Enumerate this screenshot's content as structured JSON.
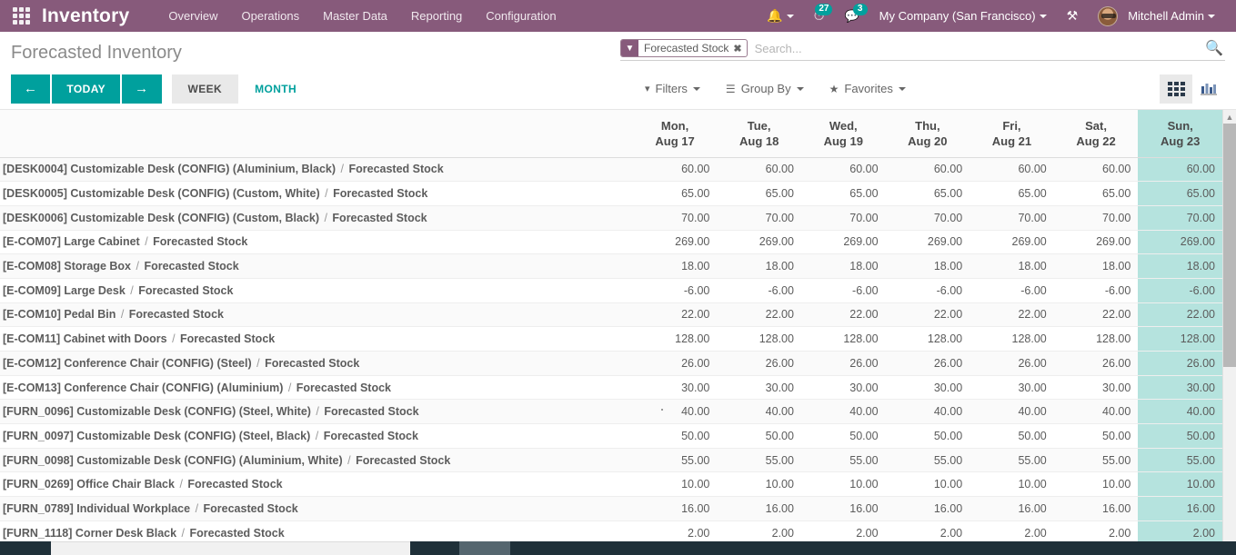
{
  "navbar": {
    "apps_icon": "apps-grid-icon",
    "brand": "Inventory",
    "menus": [
      "Overview",
      "Operations",
      "Master Data",
      "Reporting",
      "Configuration"
    ],
    "bell_icon": "bell-icon",
    "activity_icon": "clock-icon",
    "activity_count": "27",
    "messages_icon": "chat-icon",
    "messages_count": "3",
    "company": "My Company (San Francisco)",
    "debug_icon": "tools-icon",
    "user": "Mitchell Admin",
    "avatar": "user-avatar",
    "purple": "#875A7B",
    "teal": "#00A09D"
  },
  "control_panel": {
    "title": "Forecasted Inventory",
    "prev_label": "←",
    "today_label": "TODAY",
    "next_label": "→",
    "scales": [
      {
        "label": "WEEK",
        "active": true
      },
      {
        "label": "MONTH",
        "active": false
      }
    ],
    "filters_label": "Filters",
    "groupby_label": "Group By",
    "favorites_label": "Favorites",
    "views": [
      {
        "name": "gantt-view",
        "icon": "grid-icon",
        "active": true
      },
      {
        "name": "graph-view",
        "icon": "bar-chart-icon",
        "active": false
      }
    ]
  },
  "search": {
    "facet_icon": "filter-icon",
    "facet_label": "Forecasted Stock",
    "facet_remove": "✖",
    "placeholder": "Search...",
    "value": "",
    "magnifier_icon": "search-icon"
  },
  "chart_data": {
    "type": "table",
    "title": "Forecasted Inventory",
    "columns": [
      {
        "weekday": "Mon,",
        "date": "Aug 17",
        "today": false
      },
      {
        "weekday": "Tue,",
        "date": "Aug 18",
        "today": false
      },
      {
        "weekday": "Wed,",
        "date": "Aug 19",
        "today": false
      },
      {
        "weekday": "Thu,",
        "date": "Aug 20",
        "today": false
      },
      {
        "weekday": "Fri,",
        "date": "Aug 21",
        "today": false
      },
      {
        "weekday": "Sat,",
        "date": "Aug 22",
        "today": false
      },
      {
        "weekday": "Sun,",
        "date": "Aug 23",
        "today": true
      }
    ],
    "rows": [
      {
        "code": "[DESK0004]",
        "product": "Customizable Desk (CONFIG) (Aluminium, Black)",
        "measure": "Forecasted Stock",
        "values": [
          "60.00",
          "60.00",
          "60.00",
          "60.00",
          "60.00",
          "60.00",
          "60.00"
        ]
      },
      {
        "code": "[DESK0005]",
        "product": "Customizable Desk (CONFIG) (Custom, White)",
        "measure": "Forecasted Stock",
        "values": [
          "65.00",
          "65.00",
          "65.00",
          "65.00",
          "65.00",
          "65.00",
          "65.00"
        ]
      },
      {
        "code": "[DESK0006]",
        "product": "Customizable Desk (CONFIG) (Custom, Black)",
        "measure": "Forecasted Stock",
        "values": [
          "70.00",
          "70.00",
          "70.00",
          "70.00",
          "70.00",
          "70.00",
          "70.00"
        ]
      },
      {
        "code": "[E-COM07]",
        "product": "Large Cabinet",
        "measure": "Forecasted Stock",
        "values": [
          "269.00",
          "269.00",
          "269.00",
          "269.00",
          "269.00",
          "269.00",
          "269.00"
        ]
      },
      {
        "code": "[E-COM08]",
        "product": "Storage Box",
        "measure": "Forecasted Stock",
        "values": [
          "18.00",
          "18.00",
          "18.00",
          "18.00",
          "18.00",
          "18.00",
          "18.00"
        ]
      },
      {
        "code": "[E-COM09]",
        "product": "Large Desk",
        "measure": "Forecasted Stock",
        "values": [
          "-6.00",
          "-6.00",
          "-6.00",
          "-6.00",
          "-6.00",
          "-6.00",
          "-6.00"
        ]
      },
      {
        "code": "[E-COM10]",
        "product": "Pedal Bin",
        "measure": "Forecasted Stock",
        "values": [
          "22.00",
          "22.00",
          "22.00",
          "22.00",
          "22.00",
          "22.00",
          "22.00"
        ]
      },
      {
        "code": "[E-COM11]",
        "product": "Cabinet with Doors",
        "measure": "Forecasted Stock",
        "values": [
          "128.00",
          "128.00",
          "128.00",
          "128.00",
          "128.00",
          "128.00",
          "128.00"
        ]
      },
      {
        "code": "[E-COM12]",
        "product": "Conference Chair (CONFIG) (Steel)",
        "measure": "Forecasted Stock",
        "values": [
          "26.00",
          "26.00",
          "26.00",
          "26.00",
          "26.00",
          "26.00",
          "26.00"
        ]
      },
      {
        "code": "[E-COM13]",
        "product": "Conference Chair (CONFIG) (Aluminium)",
        "measure": "Forecasted Stock",
        "values": [
          "30.00",
          "30.00",
          "30.00",
          "30.00",
          "30.00",
          "30.00",
          "30.00"
        ]
      },
      {
        "code": "[FURN_0096]",
        "product": "Customizable Desk (CONFIG) (Steel, White)",
        "measure": "Forecasted Stock",
        "values": [
          "40.00",
          "40.00",
          "40.00",
          "40.00",
          "40.00",
          "40.00",
          "40.00"
        ]
      },
      {
        "code": "[FURN_0097]",
        "product": "Customizable Desk (CONFIG) (Steel, Black)",
        "measure": "Forecasted Stock",
        "values": [
          "50.00",
          "50.00",
          "50.00",
          "50.00",
          "50.00",
          "50.00",
          "50.00"
        ]
      },
      {
        "code": "[FURN_0098]",
        "product": "Customizable Desk (CONFIG) (Aluminium, White)",
        "measure": "Forecasted Stock",
        "values": [
          "55.00",
          "55.00",
          "55.00",
          "55.00",
          "55.00",
          "55.00",
          "55.00"
        ]
      },
      {
        "code": "[FURN_0269]",
        "product": "Office Chair Black",
        "measure": "Forecasted Stock",
        "values": [
          "10.00",
          "10.00",
          "10.00",
          "10.00",
          "10.00",
          "10.00",
          "10.00"
        ]
      },
      {
        "code": "[FURN_0789]",
        "product": "Individual Workplace",
        "measure": "Forecasted Stock",
        "values": [
          "16.00",
          "16.00",
          "16.00",
          "16.00",
          "16.00",
          "16.00",
          "16.00"
        ]
      },
      {
        "code": "[FURN_1118]",
        "product": "Corner Desk Black",
        "measure": "Forecasted Stock",
        "values": [
          "2.00",
          "2.00",
          "2.00",
          "2.00",
          "2.00",
          "2.00",
          "2.00"
        ]
      }
    ],
    "today_column_color": "#b5e3de",
    "separator": "/"
  }
}
